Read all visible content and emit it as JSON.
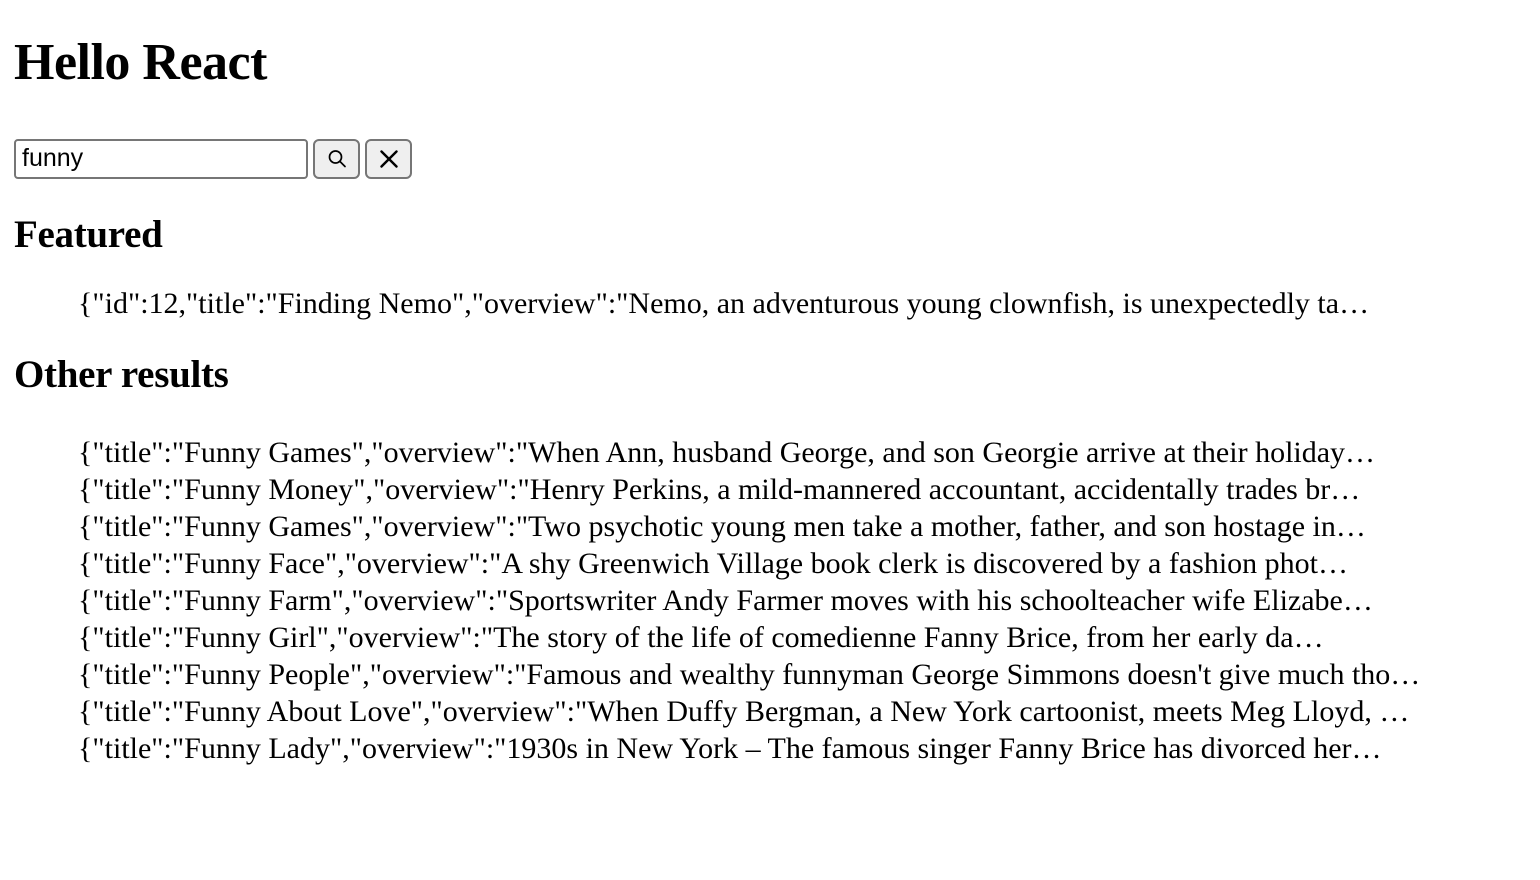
{
  "page": {
    "title": "Hello React"
  },
  "search": {
    "value": "funny",
    "placeholder": "",
    "submit_icon": "search-icon",
    "clear_icon": "close-icon"
  },
  "sections": {
    "featured": {
      "heading": "Featured",
      "items": [
        "{\"id\":12,\"title\":\"Finding Nemo\",\"overview\":\"Nemo, an adventurous young clownfish, is unexpectedly ta…"
      ]
    },
    "other": {
      "heading": "Other results",
      "items": [
        "{\"title\":\"Funny Games\",\"overview\":\"When Ann, husband George, and son Georgie arrive at their holiday…",
        "{\"title\":\"Funny Money\",\"overview\":\"Henry Perkins, a mild-mannered accountant, accidentally trades br…",
        "{\"title\":\"Funny Games\",\"overview\":\"Two psychotic young men take a mother, father, and son hostage in…",
        "{\"title\":\"Funny Face\",\"overview\":\"A shy Greenwich Village book clerk is discovered by a fashion phot…",
        "{\"title\":\"Funny Farm\",\"overview\":\"Sportswriter Andy Farmer moves with his schoolteacher wife Elizabe…",
        "{\"title\":\"Funny Girl\",\"overview\":\"The story of the life of comedienne Fanny Brice, from her early da…",
        "{\"title\":\"Funny People\",\"overview\":\"Famous and wealthy funnyman George Simmons doesn't give much tho…",
        "{\"title\":\"Funny About Love\",\"overview\":\"When Duffy Bergman, a New York cartoonist, meets Meg Lloyd, …",
        "{\"title\":\"Funny Lady\",\"overview\":\"1930s in New York – The famous singer Fanny Brice has divorced her…"
      ]
    }
  },
  "colors": {
    "text": "#000000",
    "background": "#ffffff",
    "border": "#767676",
    "button_fill": "#efefef"
  }
}
